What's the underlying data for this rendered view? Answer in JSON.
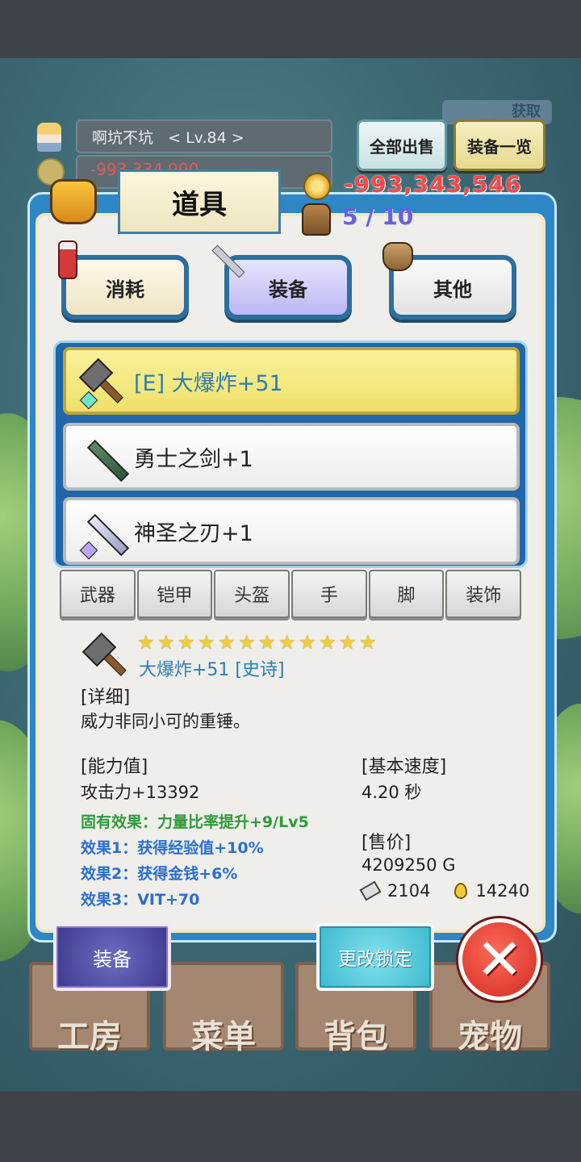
{
  "header": {
    "player_name": "啊坑不坑",
    "player_level": "< Lv.84 >",
    "player_gold_faded": "-993,334,990",
    "sell_all_label": "全部出售",
    "equip_list_label": "装备一览",
    "get_label": "获取"
  },
  "panel": {
    "title": "道具",
    "gold": "-993,343,546",
    "capacity": "5 / 10"
  },
  "tabs": [
    {
      "label": "消耗"
    },
    {
      "label": "装备"
    },
    {
      "label": "其他"
    }
  ],
  "items": [
    {
      "label": "[E] 大爆炸+51",
      "selected": true
    },
    {
      "label": "勇士之剑+1",
      "selected": false
    },
    {
      "label": "神圣之刃+1",
      "selected": false
    }
  ],
  "slots": [
    "武器",
    "铠甲",
    "头盔",
    "手",
    "脚",
    "装饰"
  ],
  "detail": {
    "star_count": 12,
    "name": "大爆炸+51 [史诗]",
    "detail_label": "[详细]",
    "description": "威力非同小可的重锤。",
    "stats_label": "[能力值]",
    "attack": "攻击力+13392",
    "effect_innate": "固有效果：力量比率提升+9/Lv5",
    "effect1": "效果1：获得经验值+10%",
    "effect2": "效果2：获得金钱+6%",
    "effect3": "效果3：VIT+70",
    "speed_label": "[基本速度]",
    "speed": "4.20 秒",
    "price_label": "[售价]",
    "price": "4209250 G",
    "material1": "2104",
    "material2": "14240"
  },
  "actions": {
    "equip": "装备",
    "change_lock": "更改锁定"
  },
  "bottom_nav": [
    "工房",
    "菜单",
    "背包",
    "宠物"
  ],
  "colors": {
    "panel_blue": "#2e86c5",
    "gold_negative": "#ff4545",
    "capacity": "#6a5fe0",
    "selected_item": "#faf19a",
    "innate_effect": "#2f9a3a",
    "effect": "#2a6fd0"
  },
  "icons": [
    "hammer-icon",
    "sword-icon",
    "holy-blade-icon",
    "coin-icon",
    "backpack-icon",
    "potion-icon",
    "sack-icon",
    "close-icon"
  ]
}
